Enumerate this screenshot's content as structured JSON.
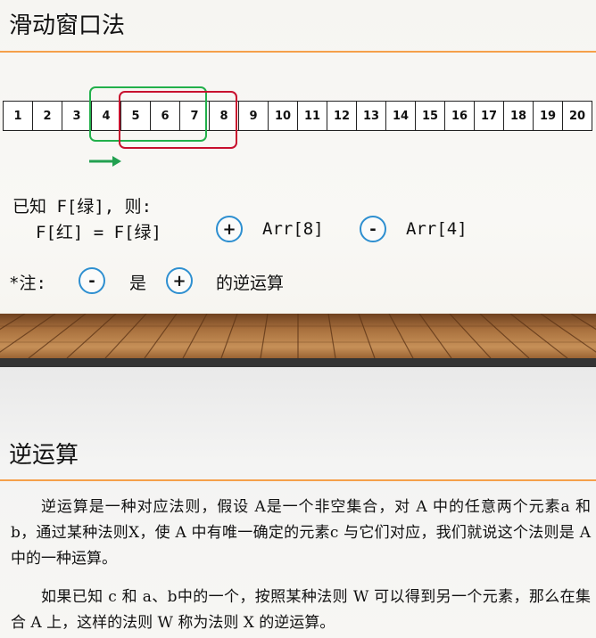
{
  "slide1": {
    "title": "滑动窗口法",
    "cells": [
      "1",
      "2",
      "3",
      "4",
      "5",
      "6",
      "7",
      "8",
      "9",
      "10",
      "11",
      "12",
      "13",
      "14",
      "15",
      "16",
      "17",
      "18",
      "19",
      "20"
    ],
    "line1": "已知 F[绿], 则:",
    "line2_part1": "F[红] = F[绿]",
    "line2_part2": "Arr[8]",
    "line2_part3": "Arr[4]",
    "plus": "+",
    "minus": "-",
    "note_prefix": "*注:",
    "note_mid": "是",
    "note_suffix": "的逆运算",
    "colors": {
      "green_window": "#22b04b",
      "red_window": "#c8102e",
      "accent_rule": "#f5a04a",
      "operator_circle": "#2e8fd0"
    }
  },
  "slide2": {
    "title": "逆运算",
    "paragraph1": "逆运算是一种对应法则，假设 A是一个非空集合，对 A 中的任意两个元素a 和 b，通过某种法则X，使 A 中有唯一确定的元素c 与它们对应，我们就说这个法则是 A 中的一种运算。",
    "paragraph2": "如果已知 c 和 a、b中的一个，按照某种法则 W 可以得到另一个元素，那么在集合 A 上，这样的法则 W 称为法则 X 的逆运算。"
  }
}
